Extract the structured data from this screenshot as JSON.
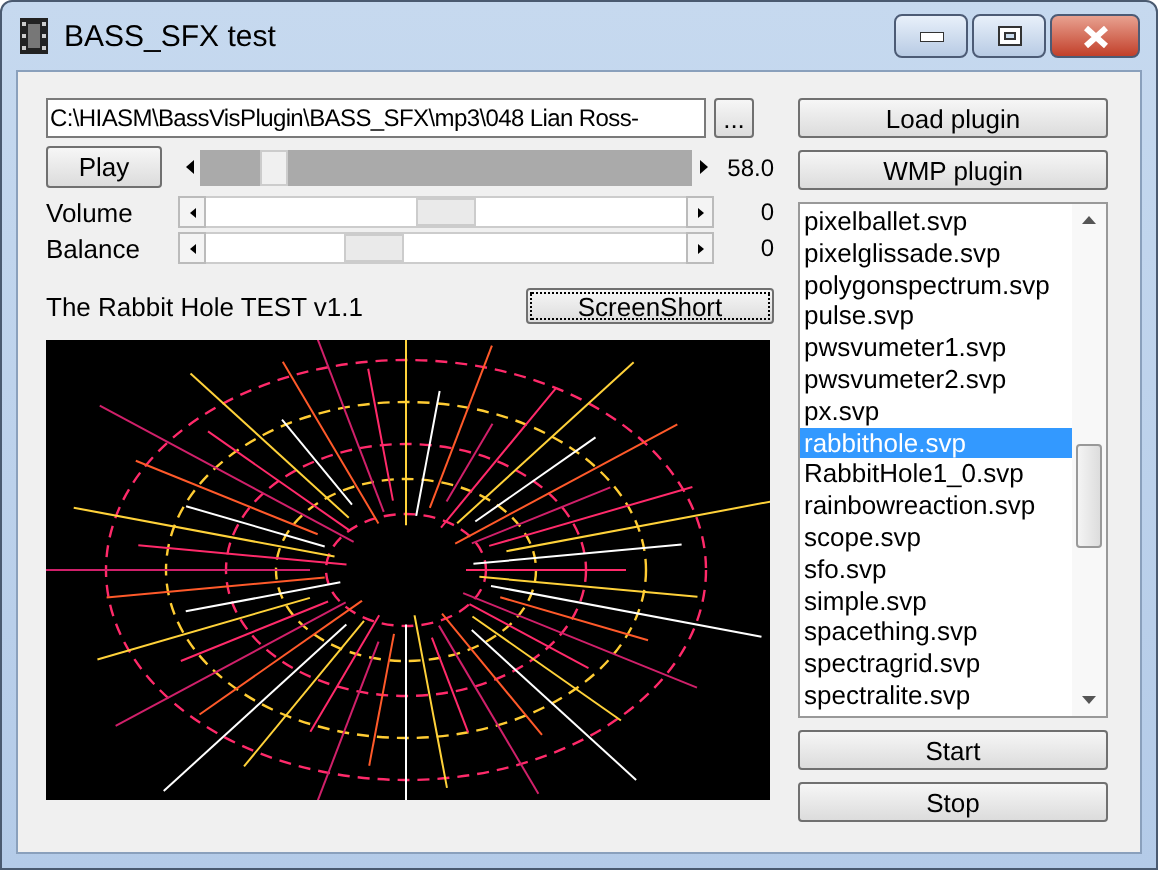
{
  "window": {
    "title": "BASS_SFX test"
  },
  "file_path": {
    "value": "C:\\HIASM\\BassVisPlugin\\BASS_SFX\\mp3\\048 Lian Ross-"
  },
  "browse_button": "...",
  "load_plugin_button": "Load plugin",
  "play_button": "Play",
  "seek": {
    "level": 0.12,
    "reading": "58.0"
  },
  "wmp_plugin_button": "WMP plugin",
  "sliders": [
    {
      "label": "Volume",
      "level": 0.5,
      "reading": "0"
    },
    {
      "label": "Balance",
      "level": 0.35,
      "reading": "0"
    }
  ],
  "plugin_name": "The Rabbit Hole TEST v1.1",
  "screenshot_button": "ScreenShort",
  "plugin_list": [
    {
      "name": "pixelballet.svp",
      "selected": false
    },
    {
      "name": "pixelglissade.svp",
      "selected": false
    },
    {
      "name": "polygonspectrum.svp",
      "selected": false
    },
    {
      "name": "pulse.svp",
      "selected": false
    },
    {
      "name": "pwsvumeter1.svp",
      "selected": false
    },
    {
      "name": "pwsvumeter2.svp",
      "selected": false
    },
    {
      "name": "px.svp",
      "selected": false
    },
    {
      "name": "rabbithole.svp",
      "selected": true
    },
    {
      "name": "RabbitHole1_0.svp",
      "selected": false
    },
    {
      "name": "rainbowreaction.svp",
      "selected": false
    },
    {
      "name": "scope.svp",
      "selected": false
    },
    {
      "name": "sfo.svp",
      "selected": false
    },
    {
      "name": "simple.svp",
      "selected": false
    },
    {
      "name": "spacething.svp",
      "selected": false
    },
    {
      "name": "spectragrid.svp",
      "selected": false
    },
    {
      "name": "spectralite.svp",
      "selected": false
    }
  ],
  "start_button": "Start",
  "stop_button": "Stop"
}
